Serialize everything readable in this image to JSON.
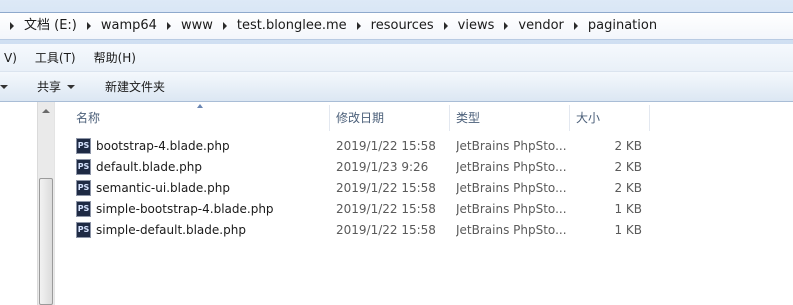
{
  "breadcrumb": {
    "items": [
      "文档 (E:)",
      "wamp64",
      "www",
      "test.blonglee.me",
      "resources",
      "views",
      "vendor",
      "pagination"
    ]
  },
  "menubar": {
    "items": [
      "V)",
      "工具(T)",
      "帮助(H)"
    ]
  },
  "commandbar": {
    "share_label": "共享",
    "new_folder_label": "新建文件夹"
  },
  "columns": {
    "name": "名称",
    "date": "修改日期",
    "type": "类型",
    "size": "大小"
  },
  "files": [
    {
      "name": "bootstrap-4.blade.php",
      "date": "2019/1/22 15:58",
      "type": "JetBrains PhpSto...",
      "size": "2 KB",
      "icon": "phpstorm-file-icon"
    },
    {
      "name": "default.blade.php",
      "date": "2019/1/23 9:26",
      "type": "JetBrains PhpSto...",
      "size": "2 KB",
      "icon": "phpstorm-file-icon"
    },
    {
      "name": "semantic-ui.blade.php",
      "date": "2019/1/22 15:58",
      "type": "JetBrains PhpSto...",
      "size": "2 KB",
      "icon": "phpstorm-file-icon"
    },
    {
      "name": "simple-bootstrap-4.blade.php",
      "date": "2019/1/22 15:58",
      "type": "JetBrains PhpSto...",
      "size": "1 KB",
      "icon": "phpstorm-file-icon"
    },
    {
      "name": "simple-default.blade.php",
      "date": "2019/1/22 15:58",
      "type": "JetBrains PhpSto...",
      "size": "1 KB",
      "icon": "phpstorm-file-icon"
    }
  ],
  "colors": {
    "header_text": "#4c607a",
    "addressbar_bg": "#dde9f7"
  }
}
